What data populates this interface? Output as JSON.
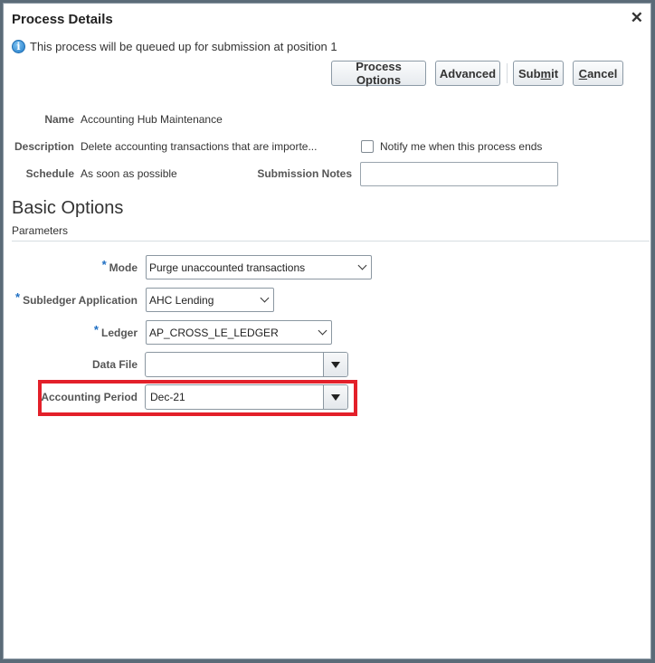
{
  "dialog": {
    "title": "Process Details",
    "close_icon": "close-icon",
    "info_icon": "info-icon",
    "info_message": "This process will be queued up for submission at position 1"
  },
  "toolbar": {
    "process_options_label": "Process Options",
    "advanced_label": "Advanced",
    "submit_label_pre": "Sub",
    "submit_label_mnemonic": "m",
    "submit_label_post": "it",
    "cancel_label_mnemonic": "C",
    "cancel_label_post": "ancel"
  },
  "details": {
    "name_label": "Name",
    "name_value": "Accounting Hub Maintenance",
    "description_label": "Description",
    "description_value": "Delete accounting transactions that are importe...",
    "schedule_label": "Schedule",
    "schedule_value": "As soon as possible",
    "notify_label": "Notify me when this process ends",
    "notify_checked": false,
    "submission_notes_label": "Submission Notes",
    "submission_notes_value": ""
  },
  "basic_options": {
    "heading": "Basic Options",
    "subheading": "Parameters",
    "required_marker": "*",
    "parameters": [
      {
        "label": "Mode",
        "value": "Purge unaccounted transactions",
        "required": true,
        "type": "select"
      },
      {
        "label": "Subledger Application",
        "value": "AHC Lending",
        "required": true,
        "type": "select"
      },
      {
        "label": "Ledger",
        "value": "AP_CROSS_LE_LEDGER",
        "required": true,
        "type": "select"
      },
      {
        "label": "Data File",
        "value": "",
        "required": false,
        "type": "combobox"
      },
      {
        "label": "Accounting Period",
        "value": "Dec-21",
        "required": false,
        "type": "combobox",
        "highlighted": true
      }
    ]
  },
  "colors": {
    "highlight": "#e3202a",
    "required_asterisk": "#1f6fc3",
    "info_icon": "#1f7bc8"
  }
}
